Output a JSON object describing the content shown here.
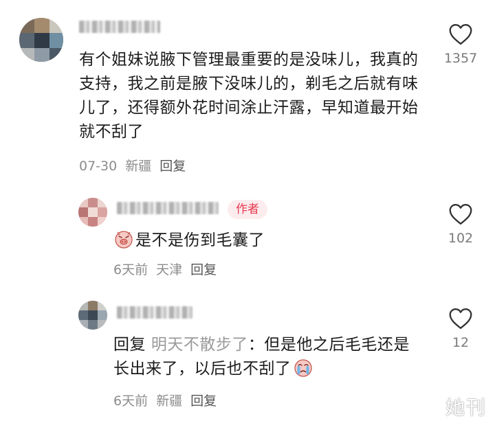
{
  "comments": [
    {
      "username": "",
      "text": "有个姐妹说腋下管理最重要的是没味儿，我真的支持，我之前是腋下没味儿的，剃毛之后就有味儿了，还得额外花时间涂止汗露，早知道最开始就不刮了",
      "date": "07-30",
      "location": "新疆",
      "reply_label": "回复",
      "likes": "1357"
    },
    {
      "username": "",
      "author_badge": "作者",
      "text": "是不是伤到毛囊了",
      "date": "6天前",
      "location": "天津",
      "reply_label": "回复",
      "likes": "102"
    },
    {
      "username": "",
      "reply_prefix": "回复",
      "mention": "明天不散步了",
      "colon": "：",
      "text": "但是他之后毛毛还是长出来了，以后也不刮了",
      "date": "6天前",
      "location": "新疆",
      "reply_label": "回复",
      "likes": "12"
    }
  ],
  "watermark": "她刊",
  "icons": {
    "like": "heart-outline-icon",
    "emoji_sad": "pig-face-emoji-icon",
    "emoji_cry": "crying-face-emoji-icon"
  }
}
